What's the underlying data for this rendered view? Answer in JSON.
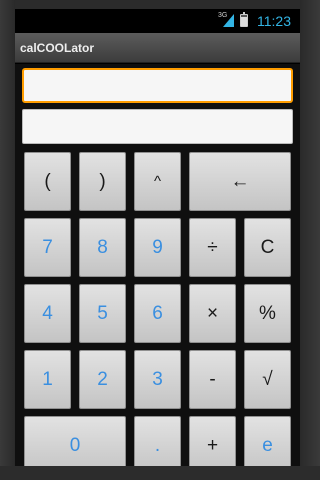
{
  "status_bar": {
    "network": "3G",
    "time": "11:23",
    "signal_color": "#33b5e5"
  },
  "app": {
    "title": "calCOOLator"
  },
  "display": {
    "expression_value": "",
    "result_value": ""
  },
  "colors": {
    "accent_focus": "#ff9d00",
    "digit_text": "#3a8fe0",
    "operator_text": "#1a1a1a"
  },
  "keys": {
    "paren_open": "(",
    "paren_close": ")",
    "power": "^",
    "backspace": "←",
    "seven": "7",
    "eight": "8",
    "nine": "9",
    "divide": "÷",
    "clear": "C",
    "four": "4",
    "five": "5",
    "six": "6",
    "multiply": "×",
    "percent": "%",
    "one": "1",
    "two": "2",
    "three": "3",
    "minus": "-",
    "sqrt": "√",
    "zero": "0",
    "dot": ".",
    "plus": "+",
    "e": "e"
  }
}
